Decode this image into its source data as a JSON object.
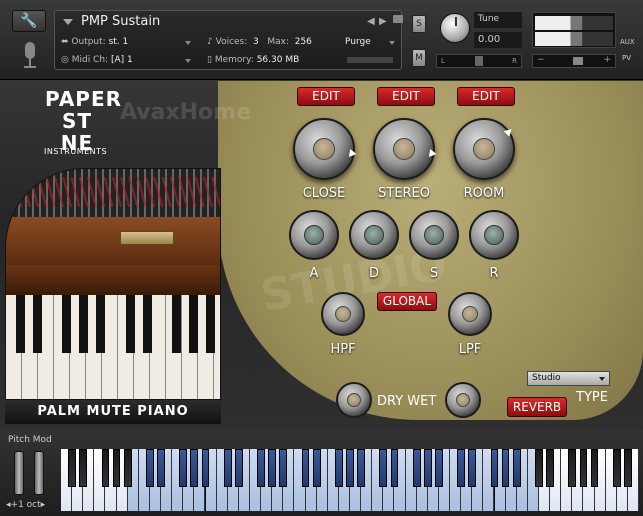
{
  "header": {
    "instrument_name": "PMP Sustain",
    "output_label": "Output:",
    "output_value": "st. 1",
    "voices_label": "Voices:",
    "voices_value": "3",
    "max_label": "Max:",
    "max_value": "256",
    "purge_label": "Purge",
    "midi_label": "Midi Ch:",
    "midi_value": "[A]  1",
    "memory_label": "Memory:",
    "memory_value": "56.30 MB",
    "solo_label": "S",
    "mute_label": "M",
    "tune_label": "Tune",
    "tune_value": "0.00",
    "pan_left": "L",
    "pan_right": "R",
    "aux_label": "AUX",
    "pv_label": "PV"
  },
  "brand": {
    "line1": "PAPER",
    "line2": "ST NE",
    "sub": "INSTRUMENTS",
    "watermark": "AvaxHome"
  },
  "instrument_title": "PALM MUTE PIANO",
  "edit_buttons": [
    "EDIT",
    "EDIT",
    "EDIT"
  ],
  "big_knobs": [
    "CLOSE",
    "STEREO",
    "ROOM"
  ],
  "adsr": [
    "A",
    "D",
    "S",
    "R"
  ],
  "global_label": "GLOBAL",
  "filters": [
    "HPF",
    "LPF"
  ],
  "drywet_label": "DRY WET",
  "reverb_label": "REVERB",
  "type_label": "TYPE",
  "reverb_type": "Studio",
  "footer": {
    "pitch_mod": "Pitch Mod",
    "octave": "+1 oct"
  },
  "colors": {
    "accent_red": "#c41e1e",
    "panel_gold": "#a89c64",
    "highlight_key": "#a9bfe0"
  }
}
